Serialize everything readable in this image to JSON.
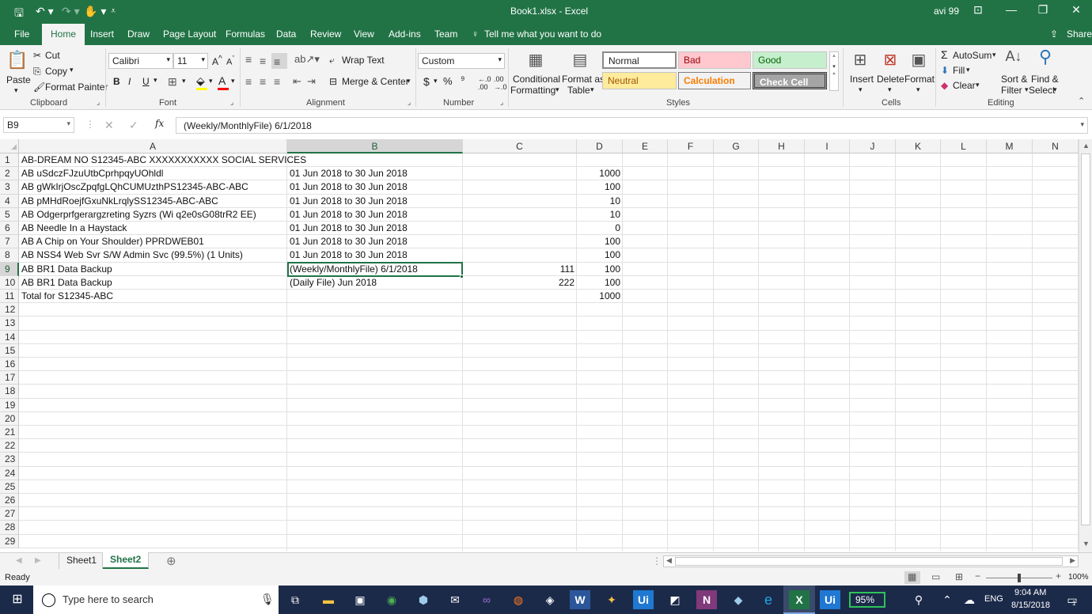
{
  "window": {
    "title": "Book1.xlsx  -  Excel",
    "user": "avi 99",
    "qat_symbols": [
      "🖫",
      "↶",
      "↷",
      "🖐"
    ]
  },
  "tabs": [
    "File",
    "Home",
    "Insert",
    "Draw",
    "Page Layout",
    "Formulas",
    "Data",
    "Review",
    "View",
    "Add-ins",
    "Team"
  ],
  "active_tab": "Home",
  "tell_me": "Tell me what you want to do",
  "share": "Share",
  "ribbon": {
    "clipboard": {
      "paste": "Paste",
      "cut": "Cut",
      "copy": "Copy",
      "format_painter": "Format Painter",
      "label": "Clipboard"
    },
    "font": {
      "name": "Calibri",
      "size": "11",
      "bold": "B",
      "italic": "I",
      "underline": "U",
      "label": "Font"
    },
    "alignment": {
      "wrap": "Wrap Text",
      "merge": "Merge & Center",
      "label": "Alignment"
    },
    "number": {
      "format": "Custom",
      "currency": "$",
      "percent": "%",
      "comma": "⁹",
      "label": "Number"
    },
    "styles": {
      "conditional": "Conditional",
      "conditional2": "Formatting",
      "format_as": "Format as",
      "format_as2": "Table",
      "normal": "Normal",
      "bad": "Bad",
      "good": "Good",
      "neutral": "Neutral",
      "calculation": "Calculation",
      "check_cell": "Check Cell",
      "label": "Styles",
      "colors": {
        "bad_bg": "#ffc7ce",
        "bad_fg": "#9c0006",
        "good_bg": "#c6efce",
        "good_fg": "#006100",
        "neutral_bg": "#ffeb9c",
        "neutral_fg": "#9c5700",
        "calc_fg": "#fa7d00",
        "check_bg": "#a5a5a5"
      }
    },
    "cells": {
      "insert": "Insert",
      "delete": "Delete",
      "format": "Format",
      "label": "Cells"
    },
    "editing": {
      "autosum": "AutoSum",
      "fill": "Fill",
      "clear": "Clear",
      "sort": "Sort &",
      "sort2": "Filter",
      "find": "Find &",
      "find2": "Select",
      "label": "Editing"
    }
  },
  "formula_bar": {
    "name_box": "B9",
    "fx": "fx",
    "formula": "(Weekly/MonthlyFile) 6/1/2018"
  },
  "columns": [
    "A",
    "B",
    "C",
    "D",
    "E",
    "F",
    "G",
    "H",
    "I",
    "J",
    "K",
    "L",
    "M",
    "N"
  ],
  "rows": [
    {
      "n": "1",
      "A": "AB-DREAM NO S12345-ABC  XXXXXXXXXXX SOCIAL SERVICES",
      "B": "",
      "C": "",
      "D": ""
    },
    {
      "n": "2",
      "A": "AB uSdczFJzuUtbCprhpqyUOhldl",
      "B": "01 Jun 2018 to 30 Jun 2018",
      "C": "",
      "D": "1000"
    },
    {
      "n": "3",
      "A": "AB gWkIrjOscZpqfgLQhCUMUzthPS12345-ABC-ABC",
      "B": "01 Jun 2018 to 30 Jun 2018",
      "C": "",
      "D": "100"
    },
    {
      "n": "4",
      "A": "AB pMHdRoejfGxuNkLrqlySS12345-ABC-ABC",
      "B": "01 Jun 2018 to 30 Jun 2018",
      "C": "",
      "D": "10"
    },
    {
      "n": "5",
      "A": "AB Odgerprfgerargzreting Syzrs (Wi q2e0sG08trR2 EE)",
      "B": "01 Jun 2018 to 30 Jun 2018",
      "C": "",
      "D": "10"
    },
    {
      "n": "6",
      "A": "AB Needle In a Haystack",
      "B": "01 Jun 2018 to 30 Jun 2018",
      "C": "",
      "D": "0"
    },
    {
      "n": "7",
      "A": "AB A Chip on Your Shoulder) PPRDWEB01",
      "B": "01 Jun 2018 to 30 Jun 2018",
      "C": "",
      "D": "100"
    },
    {
      "n": "8",
      "A": "AB NSS4 Web Svr S/W Admin Svc (99.5%) (1 Units)",
      "B": "01 Jun 2018 to 30 Jun 2018",
      "C": "",
      "D": "100"
    },
    {
      "n": "9",
      "A": "AB BR1 Data Backup",
      "B": "(Weekly/MonthlyFile) 6/1/2018",
      "C": "111",
      "D": "100"
    },
    {
      "n": "10",
      "A": "AB BR1 Data Backup",
      "B": " (Daily File)  Jun 2018",
      "C": "222",
      "D": "100"
    },
    {
      "n": "11",
      "A": "Total for S12345-ABC",
      "B": "",
      "C": "",
      "D": "1000"
    },
    {
      "n": "12"
    },
    {
      "n": "13"
    },
    {
      "n": "14"
    },
    {
      "n": "15"
    },
    {
      "n": "16"
    },
    {
      "n": "17"
    },
    {
      "n": "18"
    },
    {
      "n": "19"
    },
    {
      "n": "20"
    },
    {
      "n": "21"
    },
    {
      "n": "22"
    },
    {
      "n": "23"
    },
    {
      "n": "24"
    },
    {
      "n": "25"
    },
    {
      "n": "26"
    },
    {
      "n": "27"
    },
    {
      "n": "28"
    },
    {
      "n": "29"
    }
  ],
  "sheets": [
    "Sheet1",
    "Sheet2"
  ],
  "active_sheet": "Sheet2",
  "status": {
    "ready": "Ready",
    "zoom": "100%"
  },
  "taskbar": {
    "search": "Type here to search",
    "battery": "95%",
    "lang": "ENG",
    "time": "9:04 AM",
    "date": "8/15/2018",
    "notif": "1"
  }
}
